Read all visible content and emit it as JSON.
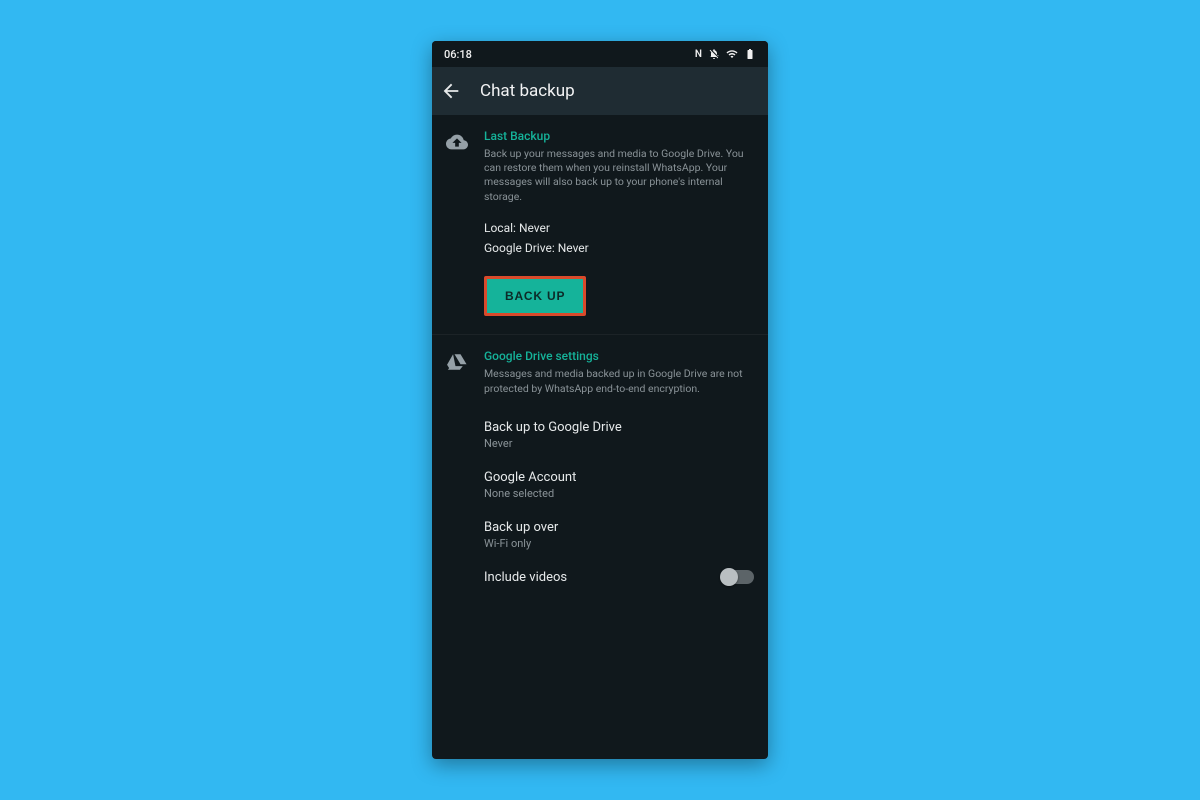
{
  "colors": {
    "accent": "#15b39a",
    "highlight_border": "#d94a2b"
  },
  "status": {
    "time": "06:18",
    "nfc": "N"
  },
  "appbar": {
    "title": "Chat backup"
  },
  "last_backup": {
    "heading": "Last Backup",
    "description": "Back up your messages and media to Google Drive. You can restore them when you reinstall WhatsApp. Your messages will also back up to your phone's internal storage.",
    "local_label": "Local:",
    "local_value": "Never",
    "drive_label": "Google Drive:",
    "drive_value": "Never",
    "button_label": "BACK UP"
  },
  "gdrive": {
    "heading": "Google Drive settings",
    "description": "Messages and media backed up in Google Drive are not protected by WhatsApp end-to-end encryption.",
    "rows": {
      "freq": {
        "label": "Back up to Google Drive",
        "value": "Never"
      },
      "account": {
        "label": "Google Account",
        "value": "None selected"
      },
      "over": {
        "label": "Back up over",
        "value": "Wi-Fi only"
      },
      "videos": {
        "label": "Include videos",
        "state": "off"
      }
    }
  }
}
